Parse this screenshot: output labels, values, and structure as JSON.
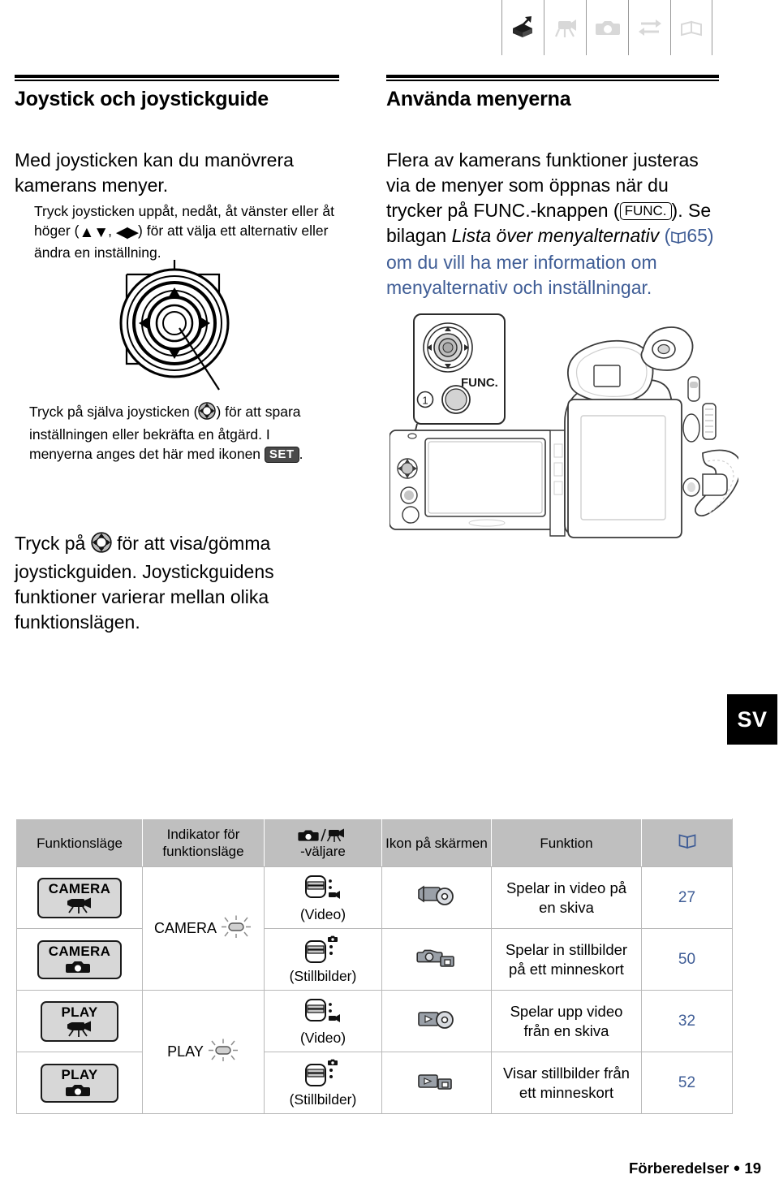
{
  "chapter_icons": [
    {
      "name": "unpacking-box-icon",
      "active": true
    },
    {
      "name": "camcorder-icon",
      "active": false
    },
    {
      "name": "photo-camera-icon",
      "active": false
    },
    {
      "name": "exchange-arrows-icon",
      "active": false
    },
    {
      "name": "open-book-icon",
      "active": false
    }
  ],
  "left_column": {
    "heading": "Joystick och joystickguide",
    "intro": "Med joysticken kan du manövrera kamerans menyer.",
    "callout_top": {
      "part1": "Tryck joysticken uppåt, nedåt, åt vänster eller åt höger (",
      "arrows_updown": "▲▼",
      "sep": ", ",
      "arrows_leftright": "◀▶",
      "part2": ") för att välja ett alternativ eller ändra en inställning."
    },
    "callout_bottom": {
      "part1": "Tryck på själva joysticken (",
      "part2": ") för att spara inställningen eller bekräfta en åtgärd. I menyerna anges det här med ikonen ",
      "set_chip": "SET",
      "part3": "."
    },
    "paragraph_guide": {
      "part1": "Tryck på ",
      "part2": " för att visa/gömma joystickguiden. Joystickguidens funktioner varierar mellan olika funktionslägen."
    }
  },
  "right_column": {
    "heading": "Använda menyerna",
    "body": {
      "part1": "Flera av kamerans funktioner justeras via de menyer som öppnas när du trycker på FUNC.-knappen (",
      "func_chip": "FUNC.",
      "part2": "). Se bilagan ",
      "italic_title": "Lista över menyalternativ",
      "part3": " (",
      "page_ref": "65",
      "part4": ") om du vill ha mer information om menyalternativ och inställningar."
    },
    "callout_number": "1",
    "func_label": "FUNC."
  },
  "sv_tab": {
    "label": "SV"
  },
  "table": {
    "headers": [
      {
        "label": "Funktionsläge",
        "icon": null
      },
      {
        "label": "Indikator för funktionsläge",
        "icon": null
      },
      {
        "label": "-väljare",
        "icon": "camera-camcorder-selector-icon"
      },
      {
        "label": "Ikon på skärmen",
        "icon": null
      },
      {
        "label": "Funktion",
        "icon": null
      },
      {
        "label": "",
        "icon": "open-book-icon"
      }
    ],
    "rows": [
      {
        "mode_word": "CAMERA",
        "mode_glyph": "camcorder-icon",
        "indicator": "CAMERA",
        "indicator_glyph": "lamp-blinking-icon",
        "indicator_rowspan": 2,
        "selector_label": "(Video)",
        "selector_glyph": "switch-video-icon",
        "screen_icon": "record-video-disc-icon",
        "function": "Spelar in video på en skiva",
        "page": "27"
      },
      {
        "mode_word": "CAMERA",
        "mode_glyph": "photo-camera-icon",
        "indicator": null,
        "indicator_glyph": null,
        "selector_label": "(Stillbilder)",
        "selector_glyph": "switch-still-icon",
        "screen_icon": "record-still-card-icon",
        "function": "Spelar in stillbilder på ett minneskort",
        "page": "50"
      },
      {
        "mode_word": "PLAY",
        "mode_glyph": "camcorder-icon",
        "indicator": "PLAY",
        "indicator_glyph": "lamp-blinking-icon",
        "indicator_rowspan": 2,
        "selector_label": "(Video)",
        "selector_glyph": "switch-video-icon",
        "screen_icon": "play-video-disc-icon",
        "function": "Spelar upp video från en skiva",
        "page": "32"
      },
      {
        "mode_word": "PLAY",
        "mode_glyph": "photo-camera-icon",
        "indicator": null,
        "indicator_glyph": null,
        "selector_label": "(Stillbilder)",
        "selector_glyph": "switch-still-icon",
        "screen_icon": "play-still-card-icon",
        "function": "Visar stillbilder från ett minneskort",
        "page": "52"
      }
    ]
  },
  "footer": {
    "section": "Förberedelser",
    "page": "19"
  }
}
